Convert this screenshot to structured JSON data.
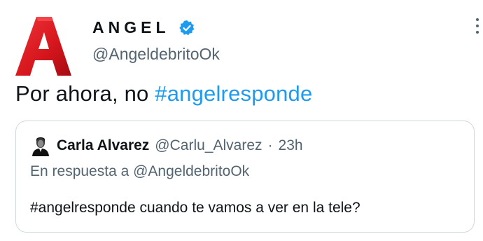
{
  "author": {
    "display_name": "ANGEL",
    "handle": "@AngeldebritoOk",
    "avatar_icon": "red-letter-a-logo",
    "verified_icon": "verified-badge-icon"
  },
  "tweet": {
    "text_prefix": "Por ahora, no ",
    "hashtag": "#angelresponde"
  },
  "quoted_tweet": {
    "avatar_icon": "profile-photo",
    "name": "Carla Alvarez",
    "handle": "@Carlu_Alvarez",
    "separator": "·",
    "time": "23h",
    "reply_to": "En respuesta a @AngeldebritoOk",
    "text": "#angelresponde cuando te vamos a ver en la tele?"
  },
  "colors": {
    "accent": "#1d9bf0",
    "logo_red": "#d4151c",
    "muted": "#536471",
    "border": "#cfd9de"
  }
}
